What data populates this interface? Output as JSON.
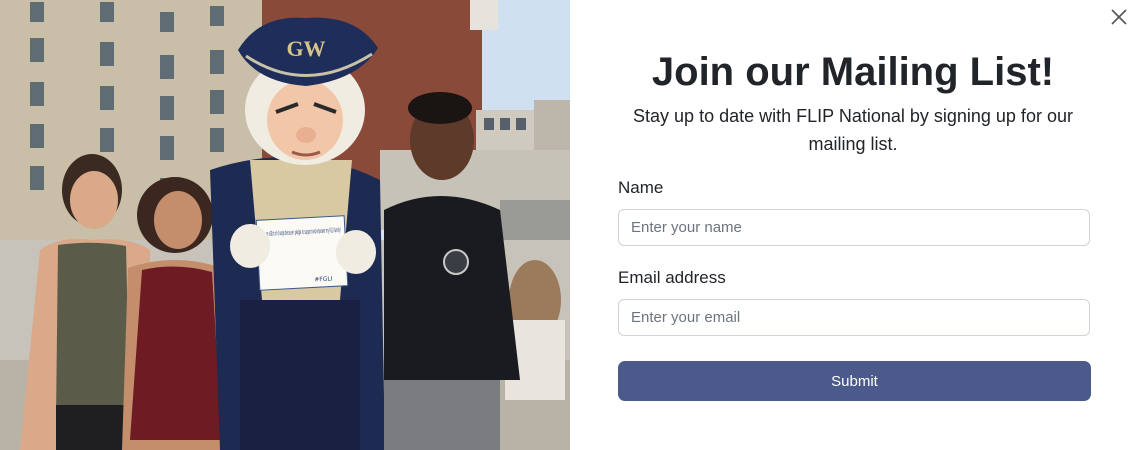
{
  "modal": {
    "close_icon": "close-icon",
    "title": "Join our Mailing List!",
    "subtitle": "Stay up to date with FLIP National by signing up for our mailing list.",
    "photo": {
      "hat_text": "GW",
      "sign_text": "I am an aGEnt of change because I pledge to support and empower my FGLI family!",
      "sign_tag": "#FGLI"
    },
    "form": {
      "name_label": "Name",
      "name_placeholder": "Enter your name",
      "name_value": "",
      "email_label": "Email address",
      "email_placeholder": "Enter your email",
      "email_value": "",
      "submit_label": "Submit"
    },
    "colors": {
      "submit_bg": "#4b5a8a",
      "input_border": "#ced4da",
      "text": "#212529"
    }
  }
}
